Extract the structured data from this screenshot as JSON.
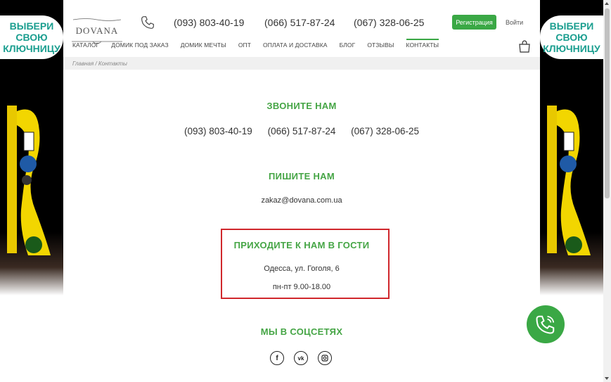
{
  "promo": {
    "line1": "ВЫБЕРИ",
    "line2": "СВОЮ",
    "line3": "КЛЮЧНИЦУ"
  },
  "header": {
    "logo": "DOVANA",
    "phones": [
      "(093) 803-40-19",
      "(066) 517-87-24",
      "(067) 328-06-25"
    ],
    "register_label": "Регистрация",
    "login_label": "Войти",
    "accent_color": "#3aa845"
  },
  "nav": {
    "items": [
      "КАТАЛОГ",
      "ДОМИК ПОД ЗАКАЗ",
      "ДОМИК МЕЧТЫ",
      "ОПТ",
      "ОПЛАТА И ДОСТАВКА",
      "БЛОГ",
      "ОТЗЫВЫ",
      "КОНТАКТЫ"
    ],
    "active": "КОНТАКТЫ"
  },
  "breadcrumb": "Главная / Контакты",
  "content": {
    "call_title": "ЗВОНИТЕ НАМ",
    "phones": [
      "(093) 803-40-19",
      "(066) 517-87-24",
      "(067) 328-06-25"
    ],
    "write_title": "ПИШИТЕ НАМ",
    "email": "zakaz@dovana.com.ua",
    "visit_title": "ПРИХОДИТЕ К НАМ В ГОСТИ",
    "address": "Одесса, ул. Гоголя, 6",
    "hours": "пн-пт 9.00-18.00",
    "social_title": "МЫ В СОЦСЕТЯХ",
    "socials": [
      "facebook-icon",
      "vk-icon",
      "instagram-icon"
    ]
  },
  "highlight_color": "#d0272c"
}
